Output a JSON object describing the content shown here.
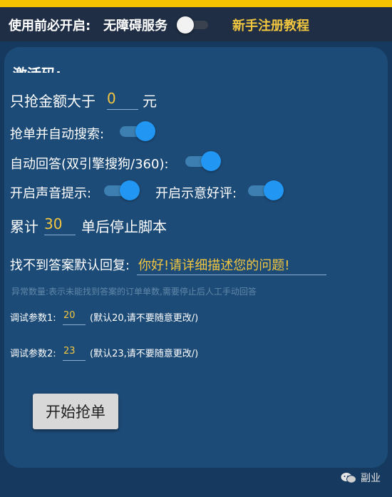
{
  "topbar": {
    "prefix_label": "使用前必开启:",
    "service_label": "无障碍服务",
    "service_enabled": false,
    "tutorial_link": "新手注册教程"
  },
  "panel": {
    "cut_title": "激活码:",
    "min_amount": {
      "label": "只抢金额大于",
      "value": "0",
      "unit": "元"
    },
    "auto_search": {
      "label": "抢单并自动搜索:",
      "enabled": true
    },
    "auto_reply": {
      "label": "自动回答(双引擎搜狗/360):",
      "enabled": true
    },
    "sound_tip": {
      "label": "开启声音提示:",
      "enabled": true
    },
    "good_review": {
      "label": "开启示意好评:",
      "enabled": true
    },
    "stop_after": {
      "prefix": "累计",
      "value": "30",
      "suffix": "单后停止脚本"
    },
    "default_reply": {
      "label": "找不到答案默认回复:",
      "value": "你好!请详细描述您的问题!"
    },
    "hint": "异常数量:表示未能找到答案的订单单数,需要停止后人工手动回答",
    "debug1": {
      "label": "调试参数1:",
      "value": "20",
      "note": "(默认20,请不要随意更改/)"
    },
    "debug2": {
      "label": "调试参数2:",
      "value": "23",
      "note": "(默认23,请不要随意更改/)"
    },
    "start_button": "开始抢单"
  },
  "watermark": {
    "text": "副业",
    "icon": "wechat-icon"
  },
  "colors": {
    "panel": "#1d4b77",
    "accent_value": "#f3c63f",
    "switch_on": "#2196f3",
    "button": "#d8d8d8"
  }
}
